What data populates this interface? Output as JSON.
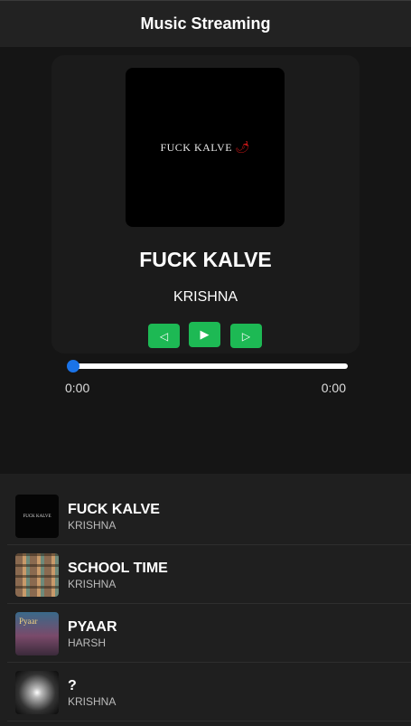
{
  "app": {
    "title": "Music Streaming"
  },
  "now_playing": {
    "cover_text": "FUCK KALVE",
    "title": "FUCK KALVE",
    "artist": "KRISHNA",
    "current_time": "0:00",
    "duration": "0:00",
    "progress": 0
  },
  "controls": {
    "prev_icon": "◁",
    "play_icon": "▶",
    "next_icon": "▷"
  },
  "playlist": [
    {
      "title": "FUCK KALVE",
      "artist": "KRISHNA",
      "thumb_text": "FUCK KALVE",
      "icon": "album-art-kalve"
    },
    {
      "title": "SCHOOL TIME",
      "artist": "KRISHNA",
      "icon": "album-art-school-time"
    },
    {
      "title": "PYAAR",
      "artist": "HARSH",
      "thumb_text": "Pyaar",
      "icon": "album-art-pyaar"
    },
    {
      "title": "?",
      "artist": "KRISHNA",
      "icon": "album-art-question"
    }
  ],
  "colors": {
    "accent": "#1db954",
    "seek_thumb": "#1a73e8",
    "background": "#151515"
  }
}
